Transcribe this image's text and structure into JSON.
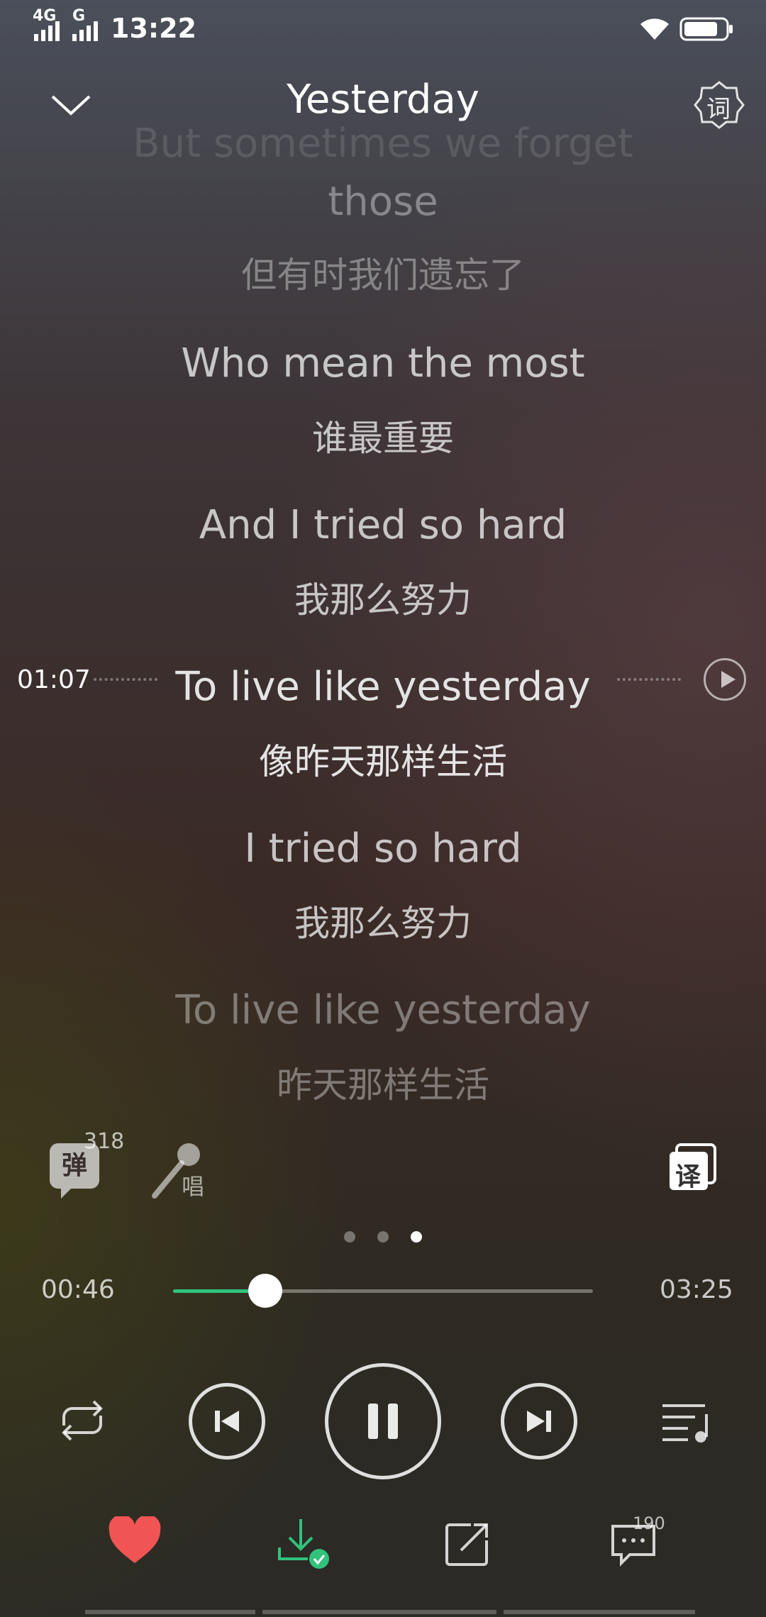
{
  "status_bar": {
    "network_1": "4G",
    "network_2": "G",
    "time": "13:22",
    "icons": [
      "wifi-icon",
      "battery-icon"
    ]
  },
  "header": {
    "title": "Yesterday",
    "lyric_settings_label": "词"
  },
  "lyrics": [
    {
      "text": "But sometimes we forget",
      "style": "fading"
    },
    {
      "text": "those",
      "style": "faded"
    },
    {
      "text": "但有时我们遗忘了",
      "style": "faded"
    },
    {
      "text": "Who mean the most",
      "style": "normal"
    },
    {
      "text": "谁最重要",
      "style": "normal"
    },
    {
      "text": "And I tried so hard",
      "style": "normal"
    },
    {
      "text": "我那么努力",
      "style": "normal"
    },
    {
      "text": "To live like yesterday",
      "style": "current"
    },
    {
      "text": "像昨天那样生活",
      "style": "current"
    },
    {
      "text": "I tried so hard",
      "style": "normal"
    },
    {
      "text": "我那么努力",
      "style": "normal"
    },
    {
      "text": "To live like yesterday",
      "style": "faded"
    },
    {
      "text": "昨天那样生活",
      "style": "faded"
    }
  ],
  "seek_indicator": {
    "time": "01:07"
  },
  "tools": {
    "danmu_label": "弹",
    "danmu_count": "318",
    "sing_label": "唱",
    "translate_label": "译"
  },
  "pager": {
    "count": 3,
    "active_index": 2
  },
  "progress": {
    "current": "00:46",
    "total": "03:25",
    "fraction": 0.22
  },
  "actions": {
    "comment_count": "190",
    "like_color": "#f05454",
    "download_badge_color": "#31c27c"
  }
}
